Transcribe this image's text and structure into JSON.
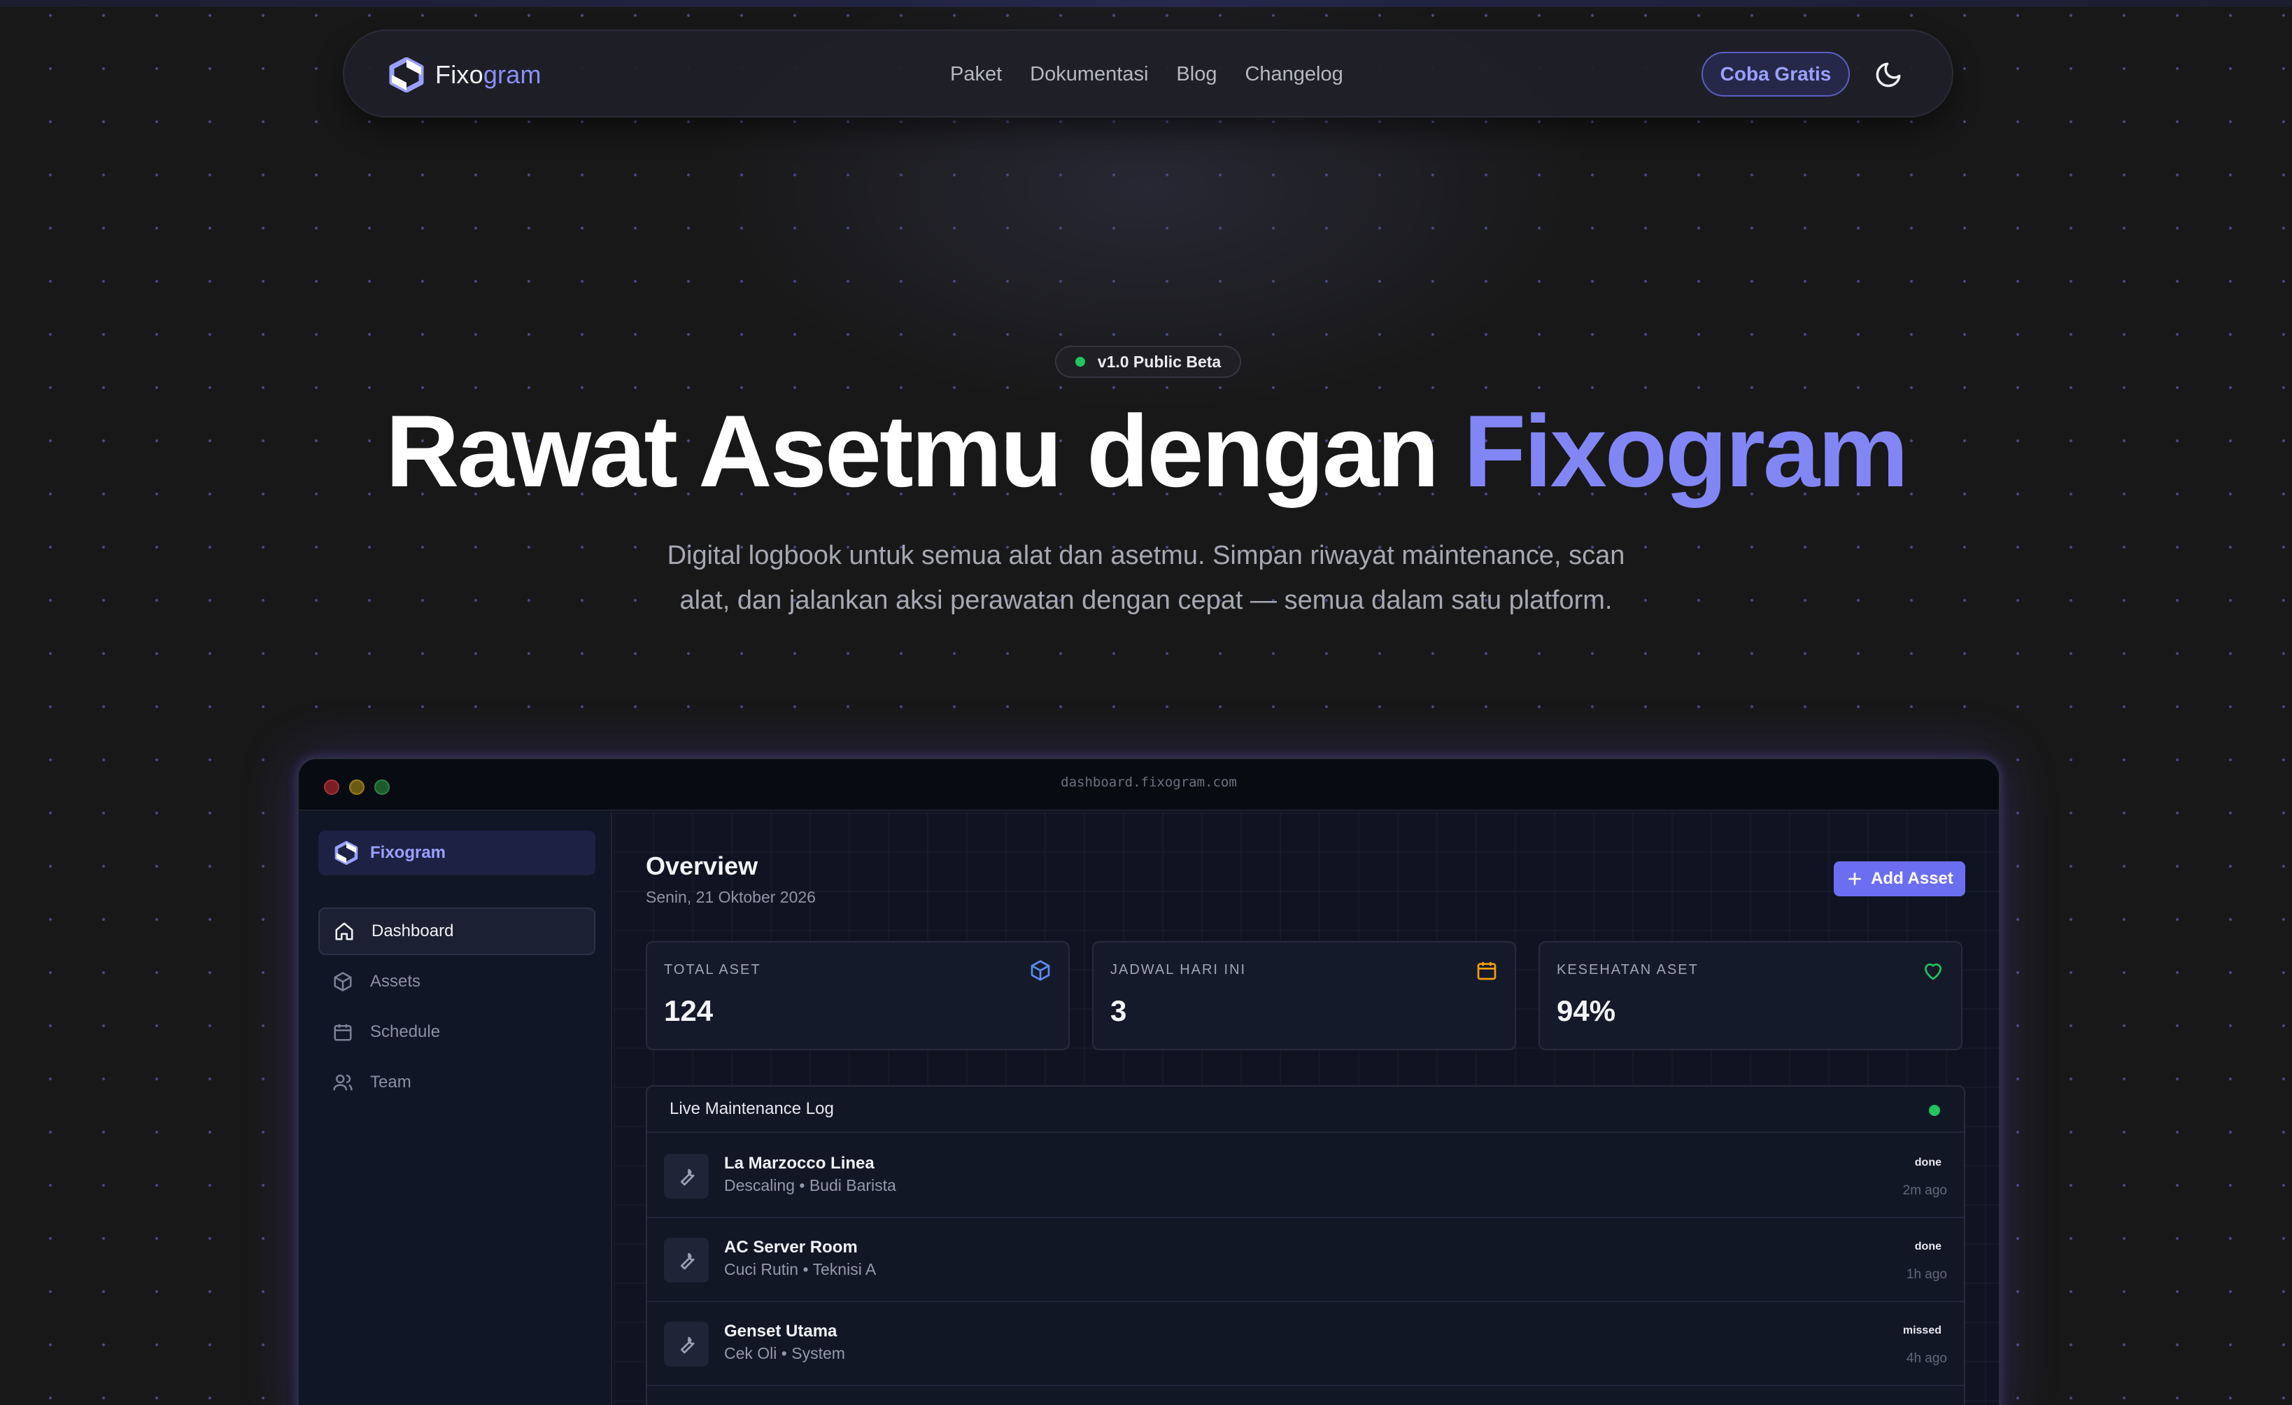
{
  "nav": {
    "brand_part1": "Fixo",
    "brand_part2": "gram",
    "links": [
      "Paket",
      "Dokumentasi",
      "Blog",
      "Changelog"
    ],
    "cta_label": "Coba Gratis",
    "theme_icon": "moon-icon"
  },
  "hero": {
    "badge": "v1.0 Public Beta",
    "headline_plain": "Rawat Asetmu dengan ",
    "headline_accent": "Fixogram",
    "subtitle_line1": "Digital logbook untuk semua alat dan asetmu. Simpan riwayat maintenance, scan",
    "subtitle_line2": "alat, dan jalankan aksi perawatan dengan cepat — semua dalam satu platform."
  },
  "dashboard": {
    "url": "dashboard.fixogram.com",
    "sidebar": {
      "brand": "Fixogram",
      "items": [
        {
          "label": "Dashboard",
          "icon": "home-icon",
          "active": true
        },
        {
          "label": "Assets",
          "icon": "box-icon",
          "active": false
        },
        {
          "label": "Schedule",
          "icon": "calendar-icon",
          "active": false
        },
        {
          "label": "Team",
          "icon": "users-icon",
          "active": false
        }
      ]
    },
    "overview": {
      "title": "Overview",
      "date": "Senin, 21 Oktober 2026",
      "add_button": "Add Asset"
    },
    "stats": [
      {
        "label": "TOTAL ASET",
        "value": "124",
        "icon": "box-icon",
        "color": "#5b8def"
      },
      {
        "label": "JADWAL HARI INI",
        "value": "3",
        "icon": "calendar-icon",
        "color": "#f59e0b"
      },
      {
        "label": "KESEHATAN ASET",
        "value": "94%",
        "icon": "heart-icon",
        "color": "#22c55e"
      }
    ],
    "log": {
      "title": "Live Maintenance Log",
      "rows": [
        {
          "name": "La Marzocco Linea",
          "meta": "Descaling • Budi Barista",
          "status": "done",
          "time": "2m ago"
        },
        {
          "name": "AC Server Room",
          "meta": "Cuci Rutin • Teknisi A",
          "status": "done",
          "time": "1h ago"
        },
        {
          "name": "Genset Utama",
          "meta": "Cek Oli • System",
          "status": "missed",
          "time": "4h ago"
        }
      ]
    }
  },
  "colors": {
    "accent": "#8286f5",
    "button": "#6c6ef2",
    "status_live": "#22c55e"
  }
}
